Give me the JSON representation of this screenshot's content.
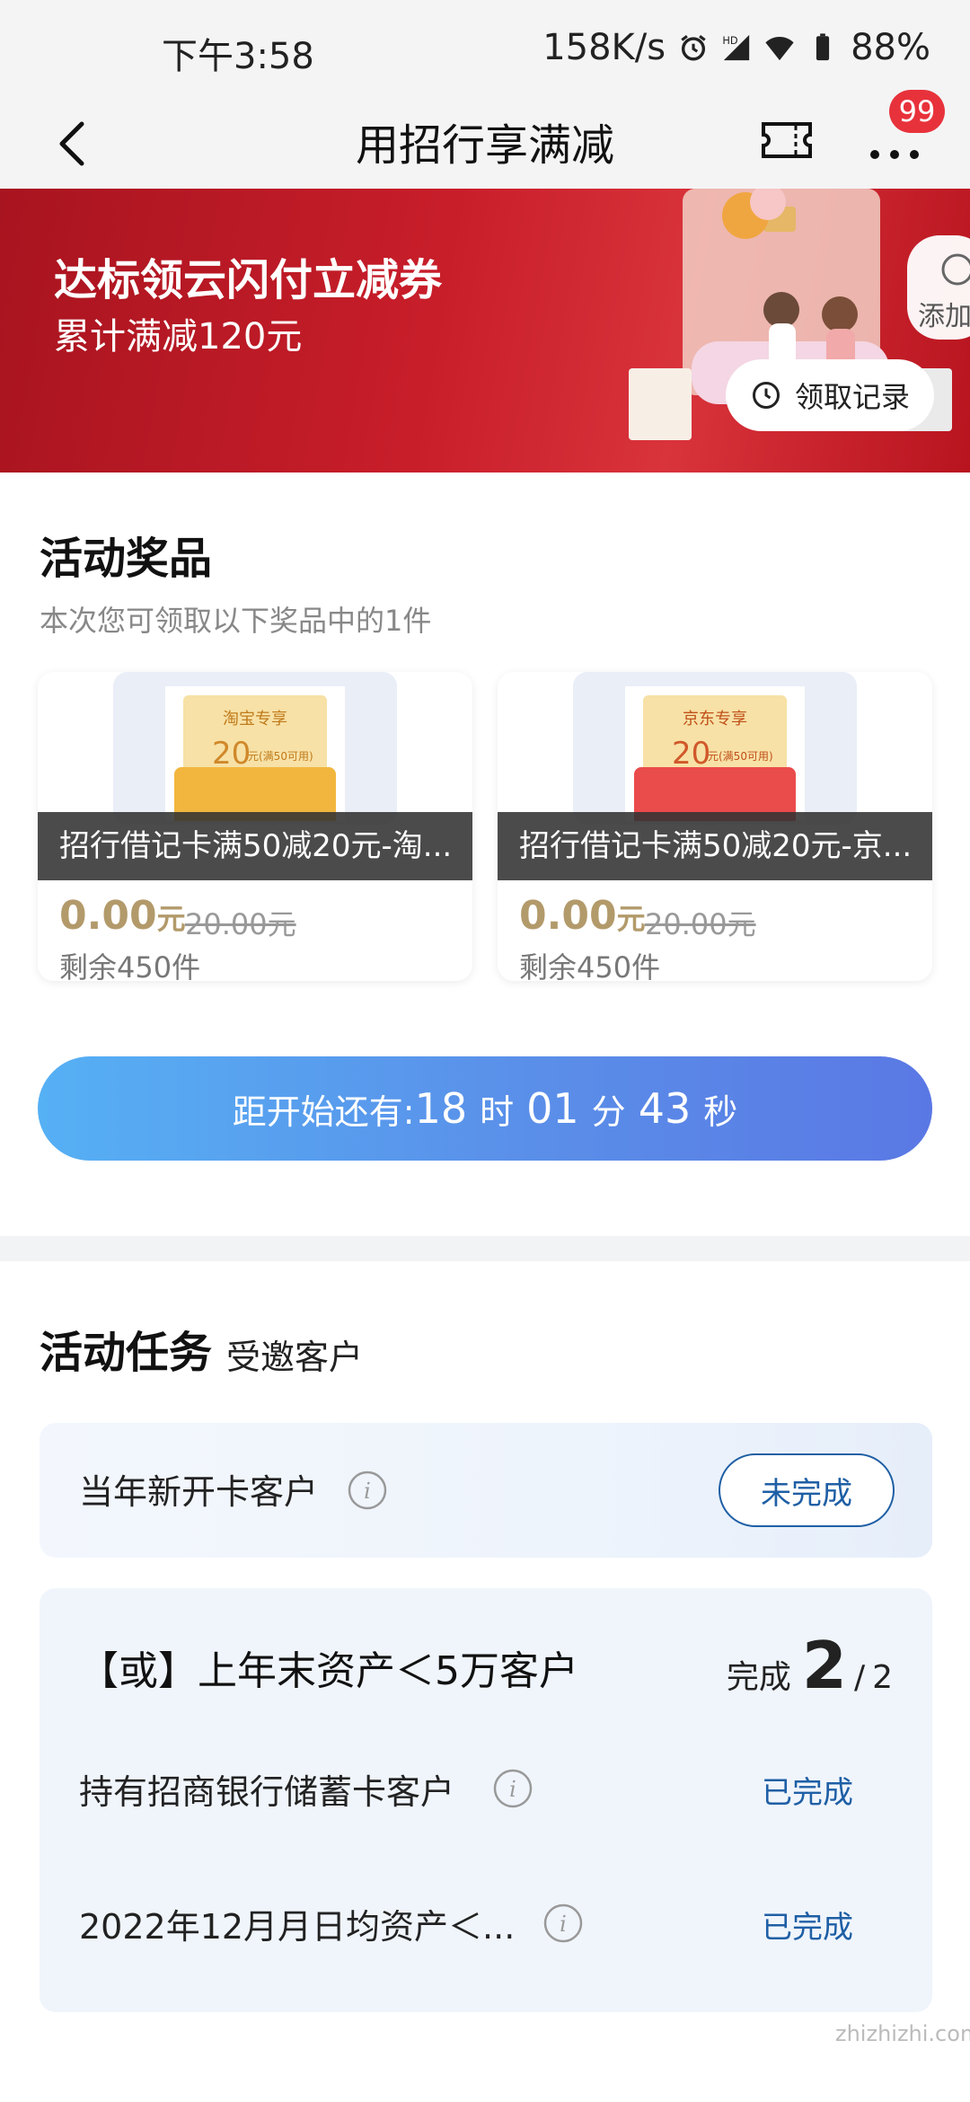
{
  "status_bar": {
    "time": "下午3:58",
    "net_speed": "158K/s",
    "battery": "88%",
    "icons": [
      "alarm-icon",
      "hd-icon",
      "signal-icon",
      "wifi-icon",
      "battery-icon"
    ]
  },
  "nav": {
    "title": "用招行享满减",
    "badge_count": "99",
    "icons": [
      "back-arrow-icon",
      "ticket-icon",
      "more-icon"
    ]
  },
  "banner": {
    "title": "达标领云闪付立减券",
    "subtitle": "累计满减120元",
    "record_button": "领取记录",
    "add_tag": "添加",
    "colors": {
      "bg": "#c81e2a"
    }
  },
  "prizes": {
    "title": "活动奖品",
    "description": "本次您可领取以下奖品中的1件",
    "items": [
      {
        "coupon_tag": "淘宝专享",
        "coupon_amount": "20",
        "coupon_condition": "元(满50可用)",
        "coupon_color": "#f2b63e",
        "label": "招行借记卡满50减20元-淘...",
        "price": "0.00",
        "price_unit": "元",
        "old_price": "20.00元",
        "remain": "剩余450件"
      },
      {
        "coupon_tag": "京东专享",
        "coupon_amount": "20",
        "coupon_condition": "元(满50可用)",
        "coupon_color": "#ea4b4b",
        "label": "招行借记卡满50减20元-京...",
        "price": "0.00",
        "price_unit": "元",
        "old_price": "20.00元",
        "remain": "剩余450件"
      }
    ],
    "countdown": {
      "prefix": "距开始还有:",
      "hours": "18",
      "hours_unit": "时",
      "minutes": "01",
      "minutes_unit": "分",
      "seconds": "43",
      "seconds_unit": "秒"
    }
  },
  "tasks": {
    "title": "活动任务",
    "subtitle": "受邀客户",
    "items": [
      {
        "name": "当年新开卡客户",
        "status": "未完成"
      }
    ],
    "or_group": {
      "title": "【或】上年末资产＜5万客户",
      "progress_label": "完成",
      "done": "2",
      "separator": "/",
      "total": "2",
      "conditions": [
        {
          "name": "持有招商银行储蓄卡客户",
          "status": "已完成"
        },
        {
          "name": "2022年12月月日均资产＜...",
          "status": "已完成"
        }
      ]
    }
  },
  "watermark": "zhizhizhi.com"
}
